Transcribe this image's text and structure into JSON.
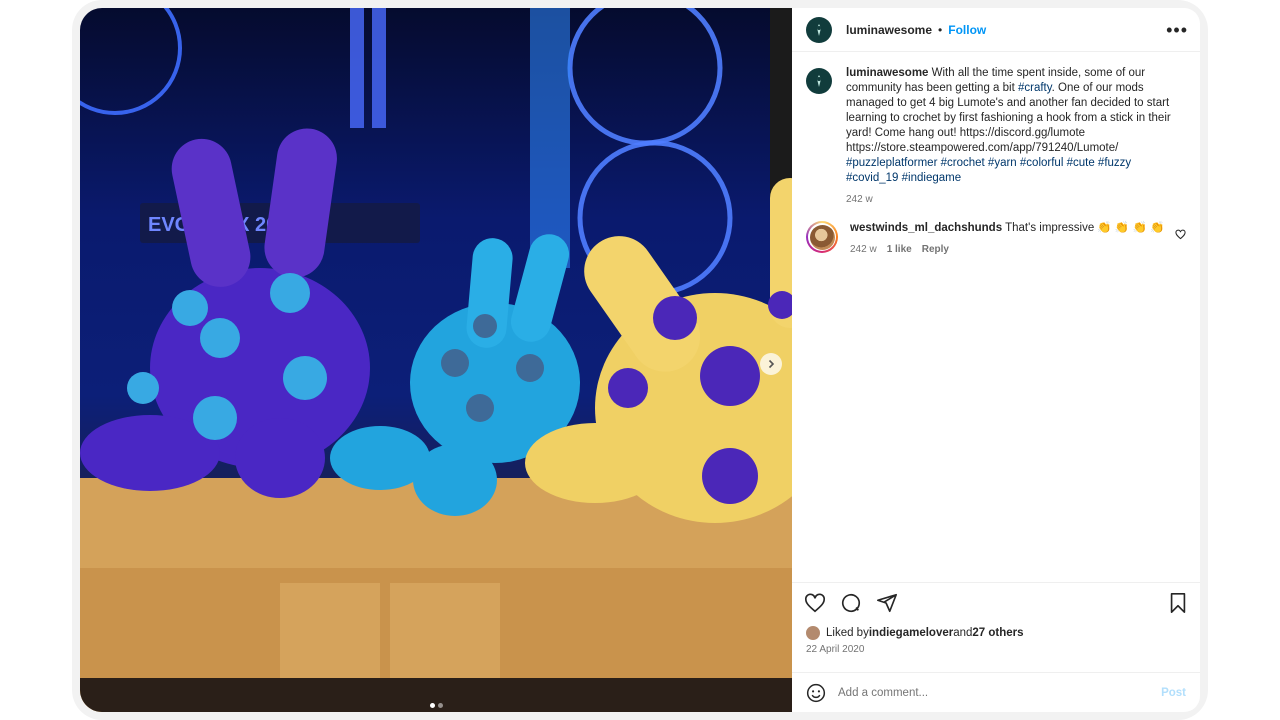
{
  "post": {
    "username": "luminawesome",
    "separator": "•",
    "follow_label": "Follow",
    "more_label": "•••",
    "media_alt": "Crocheted Lumote plush toys in purple, blue and yellow on a wooden shelf in front of a computer case",
    "media_dots": 2,
    "caption": {
      "username": "luminawesome",
      "text_1": " With all the time spent inside, some of our community has been getting a bit ",
      "tag_crafty": "#crafty",
      "text_2": ". One of our mods managed to get 4 big Lumote's and another fan decided to start learning to crochet by first fashioning a hook from a stick in their yard! Come hang out! https://discord.gg/lumote https://store.steampowered.com/app/791240/Lumote/ ",
      "tags": [
        "#puzzleplatformer",
        "#crochet",
        "#yarn",
        "#colorful",
        "#cute",
        "#fuzzy",
        "#covid_19",
        "#indiegame"
      ],
      "time": "242 w"
    },
    "comment": {
      "username": "westwinds_ml_dachshunds",
      "text": "That's impressive 👏 👏 👏 👏",
      "time": "242 w",
      "likes": "1 like",
      "reply_label": "Reply"
    },
    "likes": {
      "prefix": "Liked by ",
      "user": "indiegamelover",
      "mid": " and ",
      "others": "27 others"
    },
    "date": "22 April 2020",
    "add_comment_placeholder": "Add a comment...",
    "post_label": "Post"
  },
  "colors": {
    "accent": "#0095f6",
    "hashtag": "#00376b",
    "muted": "#737373"
  }
}
